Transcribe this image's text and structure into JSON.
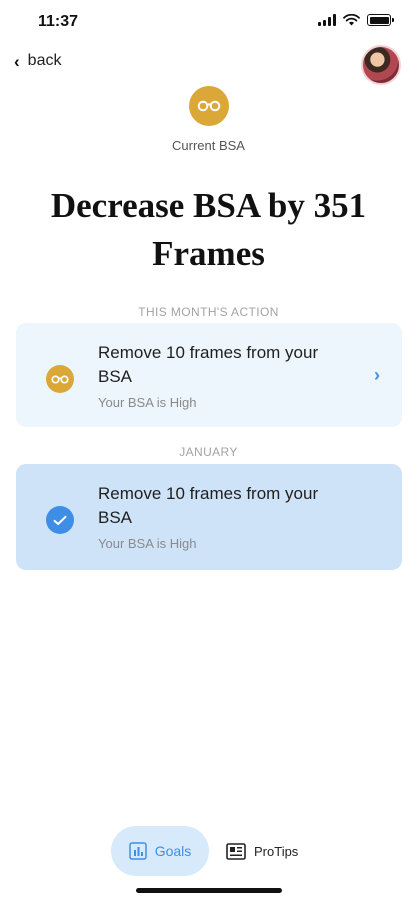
{
  "status_bar": {
    "time": "11:37"
  },
  "nav": {
    "back_label": "back",
    "back_icon": "chevron-left-icon",
    "avatar": "avatar"
  },
  "hero": {
    "icon": "glasses-icon",
    "caption": "Current BSA",
    "headline": "Decrease BSA by 351 Frames"
  },
  "sections": {
    "current_label": "THIS MONTH'S ACTION",
    "past_label": "JANUARY"
  },
  "cards": [
    {
      "title": "Remove 10 frames from your BSA",
      "subtitle": "Your BSA is High",
      "icon": "glasses-icon",
      "state": "pending"
    },
    {
      "title": "Remove 10 frames from your BSA",
      "subtitle": "Your BSA is High",
      "icon": "checkmark-icon",
      "state": "completed"
    }
  ],
  "tabs": [
    {
      "label": "Goals",
      "icon": "bar-chart-icon",
      "active": true
    },
    {
      "label": "ProTips",
      "icon": "newspaper-icon",
      "active": false
    }
  ],
  "colors": {
    "accent_blue": "#3e8ee6",
    "gold": "#dba737",
    "card_light": "#edf5fd",
    "card_done": "#cfe3f8"
  }
}
